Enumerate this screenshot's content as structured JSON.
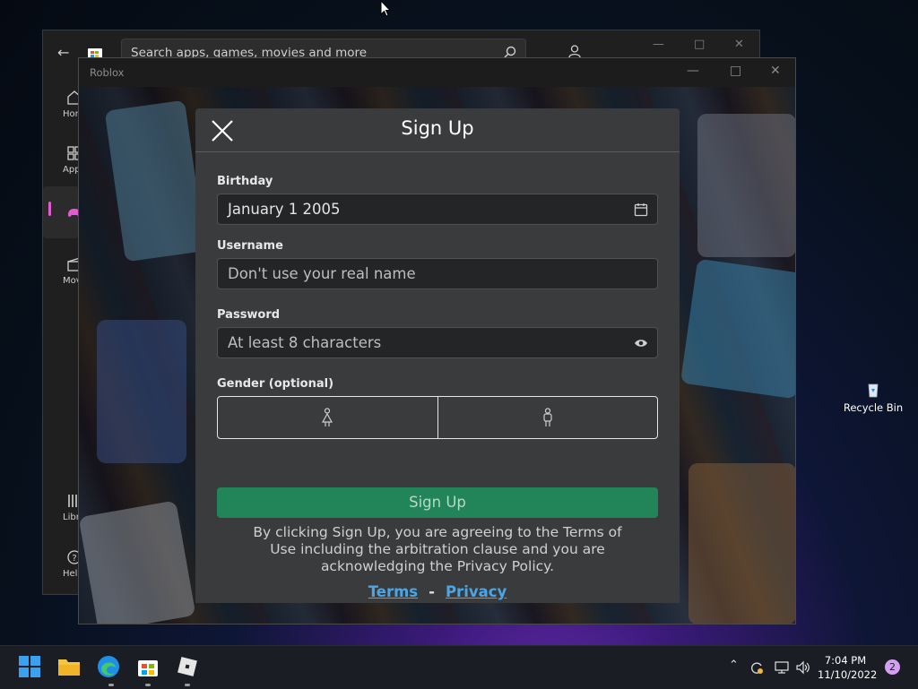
{
  "store": {
    "search_placeholder": "Search apps, games, movies and more",
    "nav": [
      {
        "label": "Home",
        "icon": "home-icon"
      },
      {
        "label": "Apps",
        "icon": "apps-icon"
      },
      {
        "label": "",
        "icon": "gaming-icon"
      },
      {
        "label": "Movies",
        "icon": "movies-icon"
      },
      {
        "label": "Library",
        "icon": "library-icon"
      },
      {
        "label": "Help",
        "icon": "help-icon"
      }
    ]
  },
  "roblox": {
    "window_title": "Roblox",
    "modal": {
      "title": "Sign Up",
      "birthday_label": "Birthday",
      "birthday_value": "January 1 2005",
      "username_label": "Username",
      "username_placeholder": "Don't use your real name",
      "password_label": "Password",
      "password_placeholder": "At least 8 characters",
      "gender_label": "Gender (optional)",
      "signup_button": "Sign Up",
      "legal_line1": "By clicking Sign Up, you are agreeing to the Terms of",
      "legal_line2": "Use including the arbitration clause and you are",
      "legal_line3": "acknowledging the Privacy Policy.",
      "terms_link": "Terms",
      "separator": "-",
      "privacy_link": "Privacy"
    }
  },
  "desktop": {
    "recycle_bin": "Recycle Bin"
  },
  "taskbar": {
    "apps": [
      "start-icon",
      "file-explorer-icon",
      "edge-icon",
      "store-icon",
      "roblox-icon"
    ],
    "time": "7:04 PM",
    "date": "11/10/2022",
    "notifications": "2"
  },
  "colors": {
    "signup_green": "#22855a",
    "link_blue": "#4aa6e8",
    "modal_bg": "#393b3d"
  }
}
